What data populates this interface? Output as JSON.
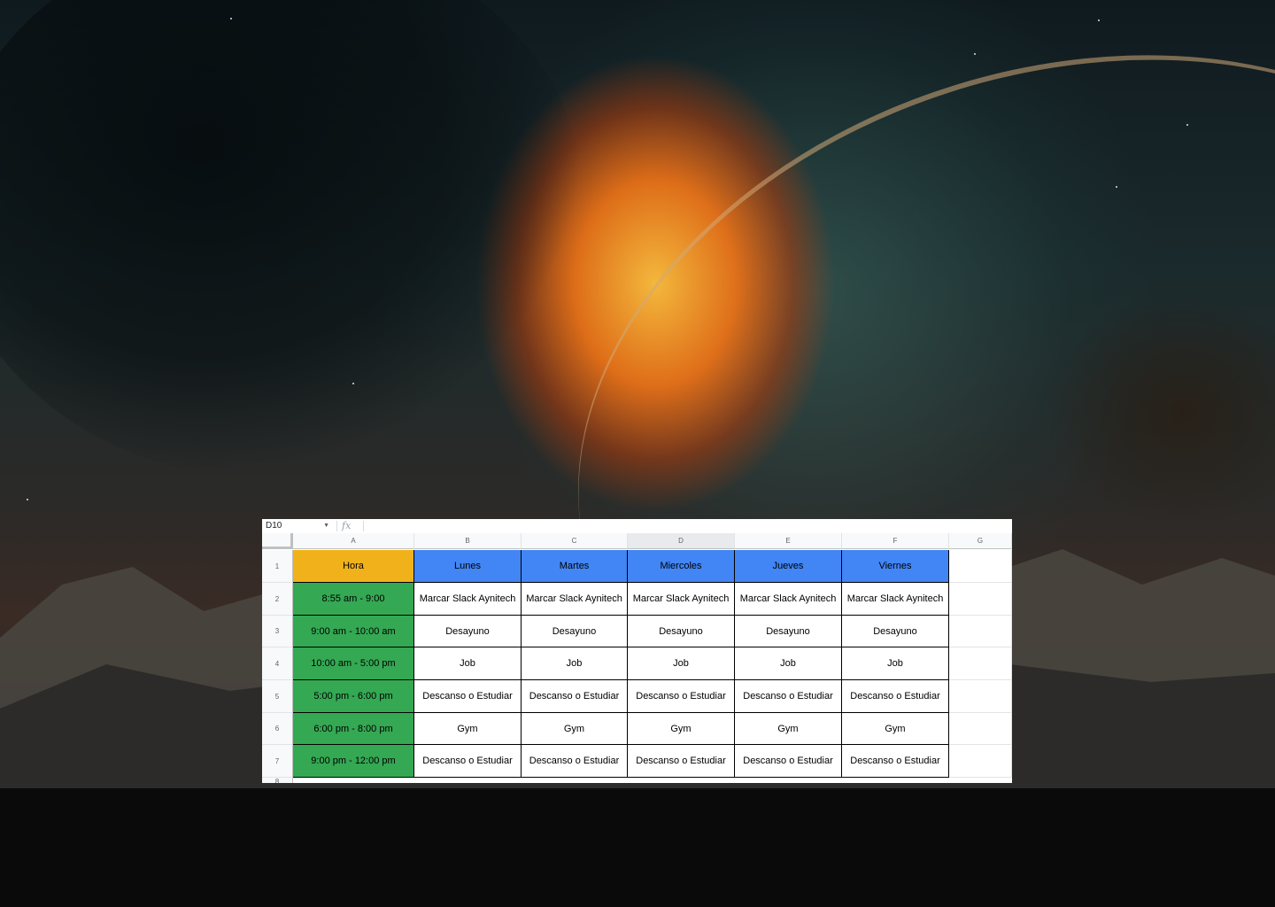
{
  "spreadsheet": {
    "name_box": "D10",
    "fx_label": "fx",
    "columns": [
      "A",
      "B",
      "C",
      "D",
      "E",
      "F",
      "G"
    ],
    "active_column": "D",
    "rows": [
      "1",
      "2",
      "3",
      "4",
      "5",
      "6",
      "7",
      "8"
    ],
    "header_row": {
      "hora": "Hora",
      "days": [
        "Lunes",
        "Martes",
        "Miercoles",
        "Jueves",
        "Viernes"
      ]
    },
    "schedule": [
      {
        "time": "8:55 am - 9:00",
        "cells": [
          "Marcar Slack Aynitech",
          "Marcar Slack Aynitech",
          "Marcar Slack Aynitech",
          "Marcar Slack Aynitech",
          "Marcar Slack Aynitech"
        ]
      },
      {
        "time": "9:00 am - 10:00 am",
        "cells": [
          "Desayuno",
          "Desayuno",
          "Desayuno",
          "Desayuno",
          "Desayuno"
        ]
      },
      {
        "time": "10:00 am - 5:00 pm",
        "cells": [
          "Job",
          "Job",
          "Job",
          "Job",
          "Job"
        ]
      },
      {
        "time": "5:00 pm - 6:00 pm",
        "cells": [
          "Descanso o Estudiar",
          "Descanso o Estudiar",
          "Descanso o Estudiar",
          "Descanso o Estudiar",
          "Descanso o Estudiar"
        ]
      },
      {
        "time": "6:00 pm - 8:00 pm",
        "cells": [
          "Gym",
          "Gym",
          "Gym",
          "Gym",
          "Gym"
        ]
      },
      {
        "time": "9:00 pm - 12:00 pm",
        "cells": [
          "Descanso o Estudiar",
          "Descanso o Estudiar",
          "Descanso o Estudiar",
          "Descanso o Estudiar",
          "Descanso o Estudiar"
        ]
      }
    ],
    "colors": {
      "hora_header": "#f1b11a",
      "day_header": "#4285f4",
      "time_cells": "#34a853"
    }
  },
  "wallpaper": {
    "description_icon": "planet-explosion-wallpaper"
  }
}
